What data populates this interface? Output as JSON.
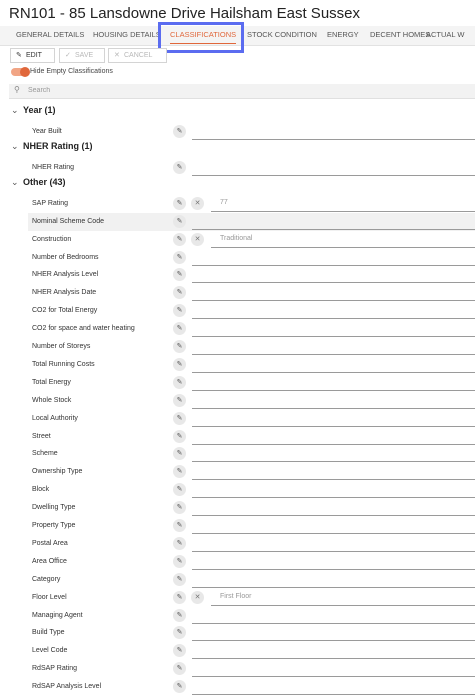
{
  "header": {
    "title": "RN101 - 85 Lansdowne Drive Hailsham East Sussex"
  },
  "tabs": [
    {
      "label": "GENERAL DETAILS"
    },
    {
      "label": "HOUSING DETAILS"
    },
    {
      "label": "CLASSIFICATIONS",
      "active": true
    },
    {
      "label": "STOCK CONDITION"
    },
    {
      "label": "ENERGY"
    },
    {
      "label": "DECENT HOMES"
    },
    {
      "label": "ACTUAL W"
    }
  ],
  "toolbar": {
    "edit": "EDIT",
    "save": "SAVE",
    "cancel": "CANCEL"
  },
  "toggle": {
    "label": "Hide Empty Classifications",
    "on": true
  },
  "search": {
    "placeholder": "Search"
  },
  "groups": [
    {
      "title": "Year (1)",
      "items": [
        {
          "label": "Year Built",
          "value": ""
        }
      ]
    },
    {
      "title": "NHER Rating (1)",
      "items": [
        {
          "label": "NHER Rating",
          "value": ""
        }
      ]
    },
    {
      "title": "Other (43)",
      "items": [
        {
          "label": "SAP Rating",
          "value": "77"
        },
        {
          "label": "Nominal Scheme Code",
          "value": ""
        },
        {
          "label": "Construction",
          "value": "Traditional"
        },
        {
          "label": "Number of Bedrooms",
          "value": ""
        },
        {
          "label": "NHER Analysis Level",
          "value": ""
        },
        {
          "label": "NHER Analysis Date",
          "value": ""
        },
        {
          "label": "CO2 for Total Energy",
          "value": ""
        },
        {
          "label": "CO2 for space and water heating",
          "value": ""
        },
        {
          "label": "Number of Storeys",
          "value": ""
        },
        {
          "label": "Total Running Costs",
          "value": ""
        },
        {
          "label": "Total Energy",
          "value": ""
        },
        {
          "label": "Whole Stock",
          "value": ""
        },
        {
          "label": "Local Authority",
          "value": ""
        },
        {
          "label": "Street",
          "value": ""
        },
        {
          "label": "Scheme",
          "value": ""
        },
        {
          "label": "Ownership Type",
          "value": ""
        },
        {
          "label": "Block",
          "value": ""
        },
        {
          "label": "Dwelling Type",
          "value": ""
        },
        {
          "label": "Property Type",
          "value": ""
        },
        {
          "label": "Postal Area",
          "value": ""
        },
        {
          "label": "Area Office",
          "value": ""
        },
        {
          "label": "Category",
          "value": ""
        },
        {
          "label": "Floor Level",
          "value": "First Floor"
        },
        {
          "label": "Managing Agent",
          "value": ""
        },
        {
          "label": "Build Type",
          "value": ""
        },
        {
          "label": "Level Code",
          "value": ""
        },
        {
          "label": "RdSAP Rating",
          "value": ""
        },
        {
          "label": "RdSAP Analysis Level",
          "value": ""
        }
      ]
    }
  ],
  "colors": {
    "accent": "#e0673b",
    "highlight": "#5b6cf0"
  },
  "icons": {
    "edit": "pencil-icon",
    "clear": "close-icon",
    "search": "search-icon",
    "collapse": "chevron-down-icon"
  }
}
